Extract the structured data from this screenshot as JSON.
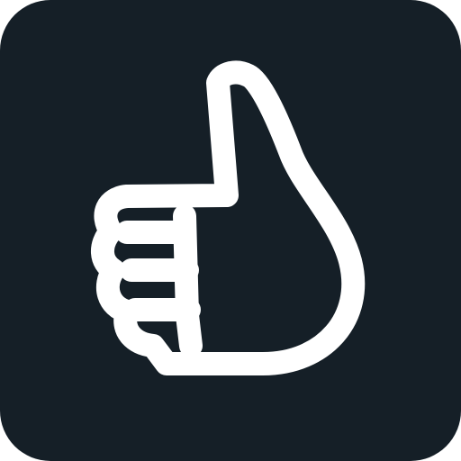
{
  "icon": {
    "name": "thumbs-up-icon",
    "background_color": "#151f27",
    "stroke_color": "#ffffff"
  }
}
